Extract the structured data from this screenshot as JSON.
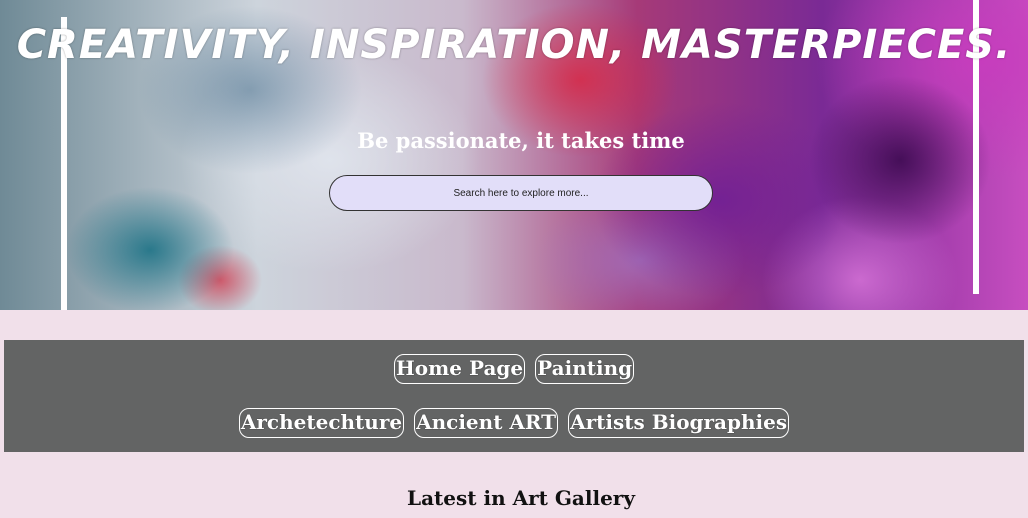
{
  "hero": {
    "title": "Creativity, Inspiration, Masterpieces.",
    "subtitle": "Be passionate, it takes time",
    "search": {
      "placeholder": "Search here to explore more...",
      "value": ""
    }
  },
  "nav": {
    "row1": [
      "Home Page",
      "Painting"
    ],
    "row2": [
      "Archetechture",
      "Ancient ART",
      "Artists Biographies"
    ]
  },
  "section": {
    "heading": "Latest in Art Gallery"
  },
  "colors": {
    "page_background": "#f1e0ea",
    "nav_background": "#636464",
    "search_background": "#e2def9"
  }
}
